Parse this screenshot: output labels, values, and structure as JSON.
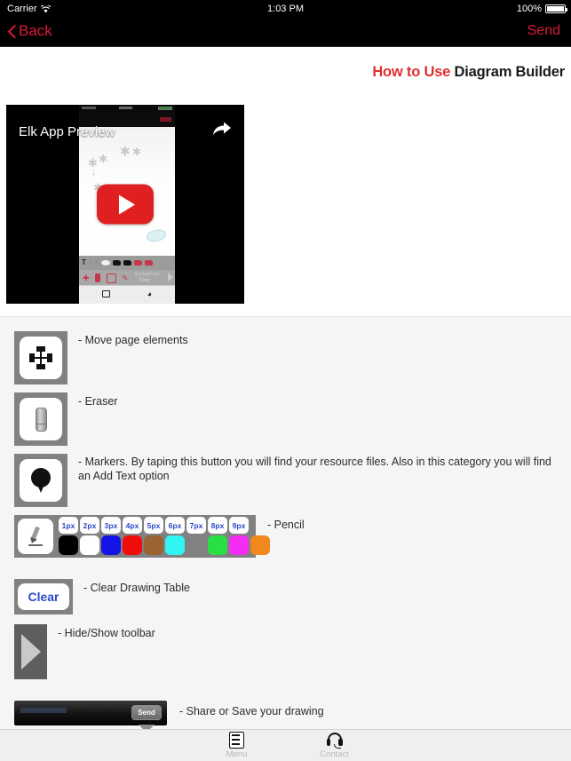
{
  "status_bar": {
    "carrier": "Carrier",
    "wifi_icon": "wifi-icon",
    "time": "1:03 PM",
    "battery_percent": "100%",
    "battery_icon": "battery-full-icon"
  },
  "nav_bar": {
    "back_label": "Back",
    "back_icon": "chevron-left-icon",
    "send_label": "Send",
    "accent_color": "#d81b35",
    "background_color": "#000000"
  },
  "page_title": {
    "highlight": "How to Use",
    "rest": "Diagram Builder",
    "highlight_color": "#e12f2f",
    "rest_color": "#1a1a1a"
  },
  "video": {
    "title": "Elk App Preview",
    "share_icon": "share-arrow-icon",
    "play_icon": "youtube-play-button",
    "play_color": "#e02020"
  },
  "instructions": [
    {
      "icon": "move-arrows-icon",
      "text": "- Move page elements"
    },
    {
      "icon": "eraser-icon",
      "text": "- Eraser"
    },
    {
      "icon": "map-pin-marker-icon",
      "text": " - Markers. By taping this button you will find your resource files. Also in this category you will find an Add Text option"
    },
    {
      "icon": "pencil-icon",
      "text": "- Pencil"
    },
    {
      "icon": "clear-button-icon",
      "text": "- Clear Drawing Table"
    },
    {
      "icon": "toolbar-toggle-triangle-icon",
      "text": "- Hide/Show toolbar"
    },
    {
      "icon": "share-bar-icon",
      "text": "- Share or Save your drawing"
    }
  ],
  "pencil_toolbar": {
    "sizes": [
      "1px",
      "2px",
      "3px",
      "4px",
      "5px",
      "6px",
      "7px",
      "8px",
      "9px"
    ],
    "size_text_color": "#2b49c9",
    "colors": [
      "#000000",
      "#ffffff",
      "#1414e6",
      "#f20d0d",
      "#9a6332",
      "#2ff5f5",
      "",
      "#28e044",
      "#f32df3",
      "#f0881e"
    ],
    "pencil_icon": "pencil-icon"
  },
  "clear_button": {
    "label": "Clear",
    "text_color": "#2b49c9"
  },
  "share_bar": {
    "send_label": "Send"
  },
  "tab_bar": {
    "items": [
      {
        "label": "Menu",
        "icon": "menu-server-icon"
      },
      {
        "label": "Contact",
        "icon": "headset-icon"
      }
    ],
    "label_color": "#b9b9b9"
  }
}
